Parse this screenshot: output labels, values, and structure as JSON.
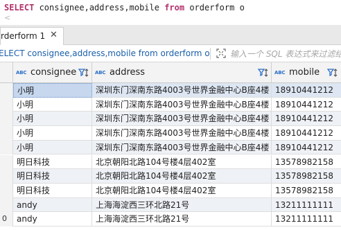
{
  "editor": {
    "keyword_select": "SELECT",
    "sql_columns": " consignee,address,mobile ",
    "keyword_from": "from",
    "sql_table": " orderform o",
    "scroll_left": "<"
  },
  "tab": {
    "label": "rderform 1",
    "close": "✕"
  },
  "querybar": {
    "query_text": "ELECT consignee,address,mobile from orderform o",
    "filter_placeholder": "输入一个 SQL 表达式来过滤结果"
  },
  "grid": {
    "columns": [
      {
        "type_badge": "ABC",
        "label": "consignee"
      },
      {
        "type_badge": "ABC",
        "label": "address"
      },
      {
        "type_badge": "ABC",
        "label": "mobile"
      }
    ],
    "rows": [
      {
        "num": "",
        "consignee": "小明",
        "address": "深圳东门深南东路4003号世界金融中心B座4楼",
        "mobile": "18910441212"
      },
      {
        "num": "",
        "consignee": "小明",
        "address": "深圳东门深南东路4003号世界金融中心B座4楼",
        "mobile": "18910441212"
      },
      {
        "num": "",
        "consignee": "小明",
        "address": "深圳东门深南东路4003号世界金融中心B座4楼",
        "mobile": "18910441212"
      },
      {
        "num": "",
        "consignee": "小明",
        "address": "深圳东门深南东路4003号世界金融中心B座4楼",
        "mobile": "18910441212"
      },
      {
        "num": "",
        "consignee": "小明",
        "address": "深圳东门深南东路4003号世界金融中心B座4楼",
        "mobile": "18910441212"
      },
      {
        "num": "",
        "consignee": "明日科技",
        "address": "北京朝阳北路104号楼4层402室",
        "mobile": "13578982158"
      },
      {
        "num": "",
        "consignee": "明日科技",
        "address": "北京朝阳北路104号楼4层402室",
        "mobile": "13578982158"
      },
      {
        "num": "",
        "consignee": "明日科技",
        "address": "北京朝阳北路104号楼4层402室",
        "mobile": "13578982158"
      },
      {
        "num": "",
        "consignee": "andy",
        "address": "上海海淀西三环北路21号",
        "mobile": "13211111111"
      },
      {
        "num": "0",
        "consignee": "andy",
        "address": "上海海淀西三环北路21号",
        "mobile": "13211111111"
      }
    ]
  },
  "colors": {
    "keyword": "#b0306a",
    "query_text": "#1a5faa",
    "type_badge": "#2a6fc9",
    "selected_cell": "#c6d7ee",
    "alt_row": "#eef1f6"
  }
}
